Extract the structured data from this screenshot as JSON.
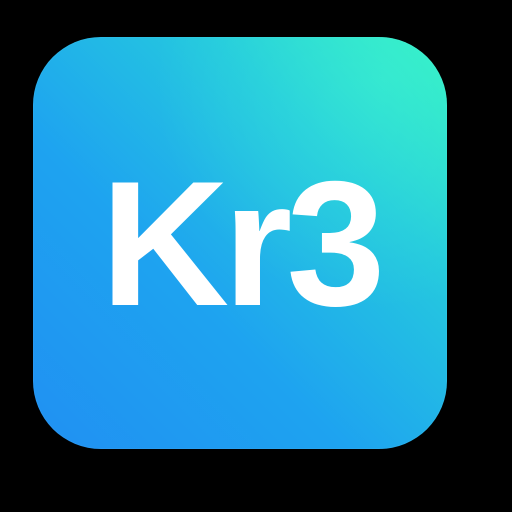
{
  "icon": {
    "label": "Kr3",
    "text_color": "#ffffff",
    "gradient_colors": [
      "#33eec4",
      "#25c9de",
      "#1ea3f0",
      "#2090f2"
    ]
  },
  "background_color": "#000000"
}
